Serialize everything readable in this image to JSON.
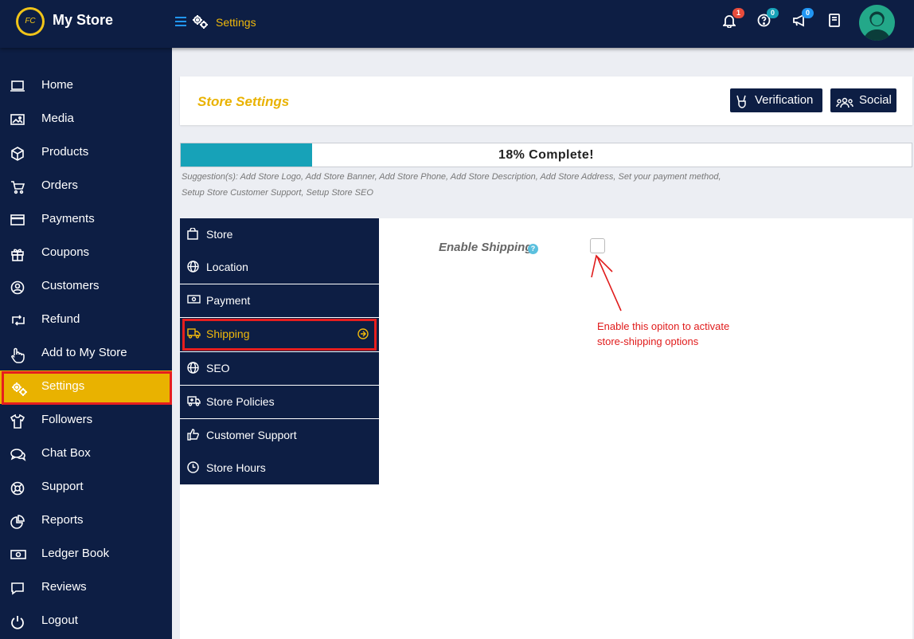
{
  "app": {
    "title": "My Store",
    "logo_text": "FC"
  },
  "header": {
    "breadcrumb": "Settings",
    "notifications_count": "1",
    "help_count": "0",
    "announcements_count": "0",
    "colors": {
      "bar": "#0d1e44",
      "accent": "#f0b90b",
      "badge_red": "#e74c3c",
      "badge_teal": "#17a2b8",
      "badge_blue": "#2196f3"
    }
  },
  "sidebar": {
    "items": [
      {
        "label": "Home",
        "icon": "monitor-icon"
      },
      {
        "label": "Media",
        "icon": "image-icon"
      },
      {
        "label": "Products",
        "icon": "cube-icon"
      },
      {
        "label": "Orders",
        "icon": "cart-icon"
      },
      {
        "label": "Payments",
        "icon": "credit-card-icon"
      },
      {
        "label": "Coupons",
        "icon": "gift-icon"
      },
      {
        "label": "Customers",
        "icon": "user-circle-icon"
      },
      {
        "label": "Refund",
        "icon": "retweet-icon"
      },
      {
        "label": "Add to My Store",
        "icon": "hand-pointer-icon"
      },
      {
        "label": "Settings",
        "icon": "gears-icon"
      },
      {
        "label": "Followers",
        "icon": "shirt-icon"
      },
      {
        "label": "Chat Box",
        "icon": "comments-icon"
      },
      {
        "label": "Support",
        "icon": "lifebuoy-icon"
      },
      {
        "label": "Reports",
        "icon": "pie-chart-icon"
      },
      {
        "label": "Ledger Book",
        "icon": "money-bill-icon"
      },
      {
        "label": "Reviews",
        "icon": "comment-icon"
      },
      {
        "label": "Logout",
        "icon": "power-icon"
      }
    ],
    "active": "Settings"
  },
  "page": {
    "title": "Store Settings",
    "verification_label": "Verification",
    "social_label": "Social",
    "progress_text": "18% Complete!",
    "progress_percent": 18,
    "suggestion_line1": "Suggestion(s): Add Store Logo, Add Store Banner, Add Store Phone, Add Store Description, Add Store Address, Set your payment method,",
    "suggestion_line2": "Setup Store Customer Support, Setup Store SEO"
  },
  "tabs": [
    {
      "label": "Store",
      "icon": "shopping-bag-icon"
    },
    {
      "label": "Location",
      "icon": "globe-icon"
    },
    {
      "label": "Payment",
      "icon": "money-icon"
    },
    {
      "label": "Shipping",
      "icon": "truck-icon"
    },
    {
      "label": "SEO",
      "icon": "globe-icon"
    },
    {
      "label": "Store Policies",
      "icon": "ambulance-icon"
    },
    {
      "label": "Customer Support",
      "icon": "thumbs-up-icon"
    },
    {
      "label": "Store Hours",
      "icon": "clock-icon"
    }
  ],
  "shipping": {
    "enable_label": "Enable Shipping",
    "help_glyph": "?",
    "enabled": false,
    "annotation_line1": "Enable this opiton to activate",
    "annotation_line2": "store-shipping  options"
  }
}
